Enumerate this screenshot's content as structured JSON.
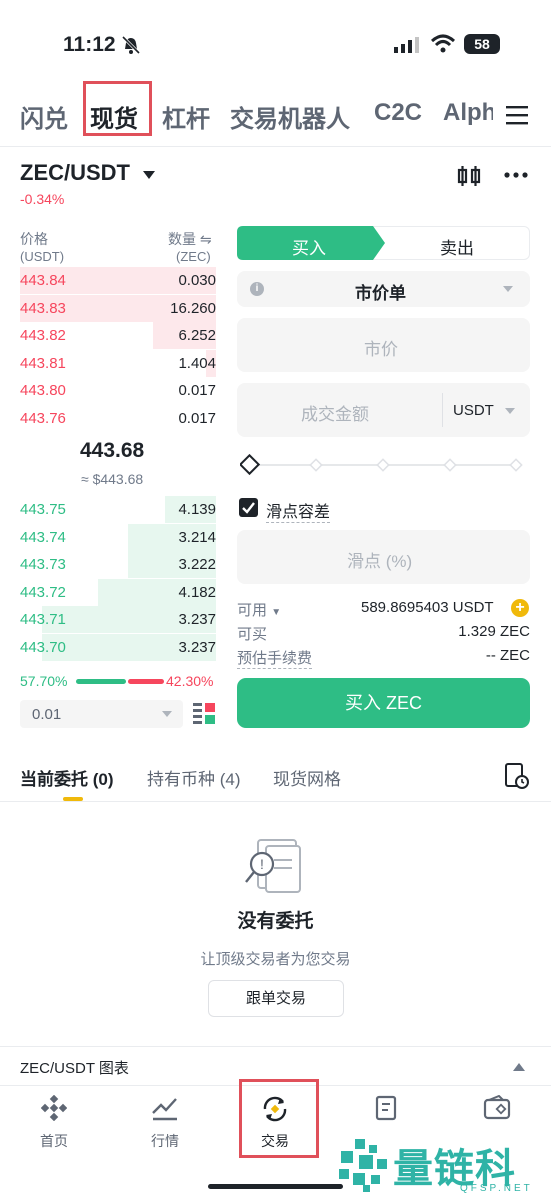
{
  "status": {
    "time": "11:12",
    "battery": "58"
  },
  "top_tabs": [
    "闪兑",
    "现货",
    "杠杆",
    "交易机器人",
    "C2C",
    "Alph"
  ],
  "pair": {
    "name": "ZEC/USDT",
    "change": "-0.34%"
  },
  "orderbook": {
    "price_label": "价格",
    "price_unit": "(USDT)",
    "qty_label": "数量",
    "qty_unit": "(ZEC)",
    "asks": [
      {
        "price": "443.84",
        "qty": "0.030",
        "depth": 1.0
      },
      {
        "price": "443.83",
        "qty": "16.260",
        "depth": 1.0
      },
      {
        "price": "443.82",
        "qty": "6.252",
        "depth": 0.32
      },
      {
        "price": "443.81",
        "qty": "1.404",
        "depth": 0.05
      },
      {
        "price": "443.80",
        "qty": "0.017",
        "depth": 0
      },
      {
        "price": "443.76",
        "qty": "0.017",
        "depth": 0
      }
    ],
    "mid_price": "443.68",
    "mid_usd": "≈ $443.68",
    "bids": [
      {
        "price": "443.75",
        "qty": "4.139",
        "depth": 0.26
      },
      {
        "price": "443.74",
        "qty": "3.214",
        "depth": 0.45
      },
      {
        "price": "443.73",
        "qty": "3.222",
        "depth": 0.45
      },
      {
        "price": "443.72",
        "qty": "4.182",
        "depth": 0.6
      },
      {
        "price": "443.71",
        "qty": "3.237",
        "depth": 0.89
      },
      {
        "price": "443.70",
        "qty": "3.237",
        "depth": 0.89
      }
    ],
    "buy_ratio": "57.70%",
    "sell_ratio": "42.30%",
    "buy_fraction": 0.577,
    "precision": "0.01"
  },
  "order_form": {
    "buy_tab": "买入",
    "sell_tab": "卖出",
    "order_type": "市价单",
    "price_placeholder": "市价",
    "amount_placeholder": "成交金额",
    "amount_unit": "USDT",
    "slippage_checkbox": "滑点容差",
    "slippage_placeholder": "滑点 (%)",
    "available_label": "可用",
    "available_value": "589.8695403 USDT",
    "can_buy_label": "可买",
    "can_buy_value": "1.329 ZEC",
    "fee_label": "预估手续费",
    "fee_value": "-- ZEC",
    "submit": "买入 ZEC"
  },
  "orders_tabs": [
    "当前委托 (0)",
    "持有币种 (4)",
    "现货网格"
  ],
  "empty": {
    "title": "没有委托",
    "subtitle": "让顶级交易者为您交易",
    "button": "跟单交易"
  },
  "chart_bar": {
    "label": "ZEC/USDT 图表"
  },
  "bottom_nav": [
    "首页",
    "行情",
    "交易"
  ],
  "watermark": {
    "text": "量链科技",
    "sub": "QFSP.NET"
  },
  "colors": {
    "green": "#2ebd85",
    "red": "#f6465d",
    "highlight": "#e0505a",
    "yellow": "#f0b90b"
  }
}
